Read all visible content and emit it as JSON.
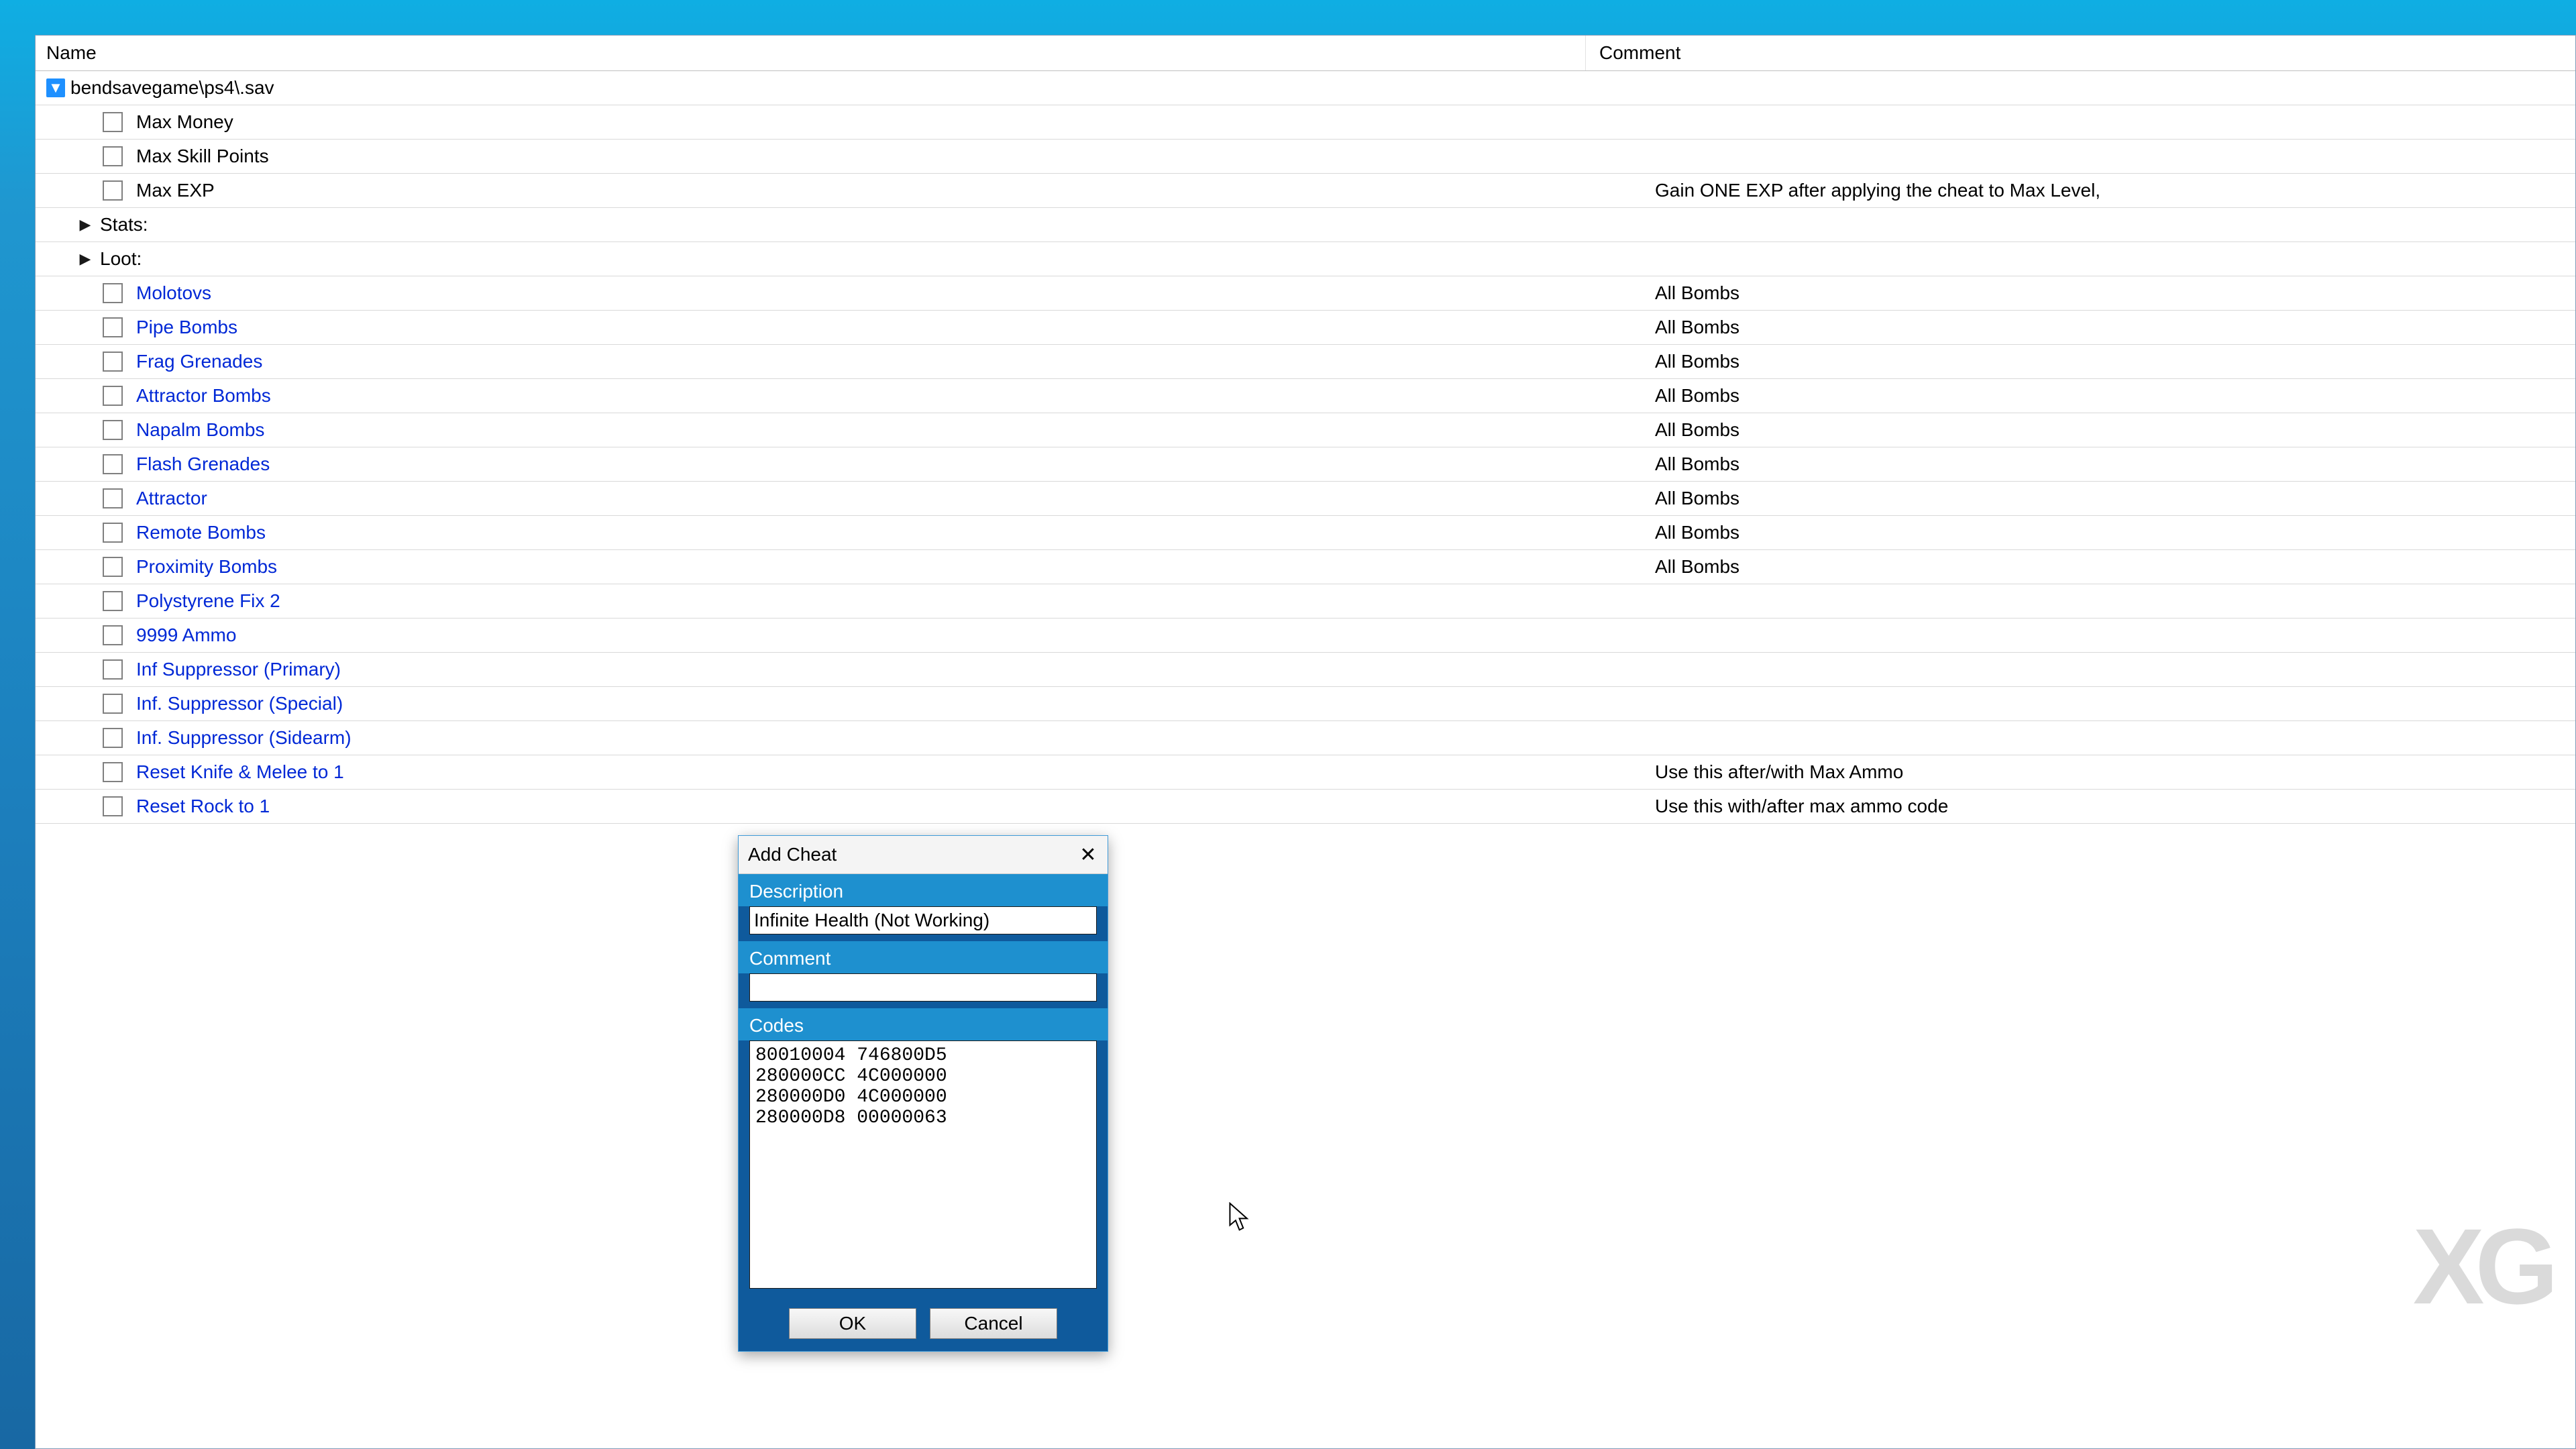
{
  "table": {
    "headers": {
      "name": "Name",
      "comment": "Comment"
    },
    "root": {
      "label": "bendsavegame\\ps4\\.sav",
      "expanded": true
    },
    "rows": [
      {
        "kind": "cb",
        "indent": 2,
        "label": "Max Money",
        "link": false,
        "comment": ""
      },
      {
        "kind": "cb",
        "indent": 2,
        "label": "Max Skill Points",
        "link": false,
        "comment": ""
      },
      {
        "kind": "cb",
        "indent": 2,
        "label": "Max EXP",
        "link": false,
        "comment": "Gain ONE EXP after applying the cheat to Max Level,"
      },
      {
        "kind": "exp",
        "indent": 1,
        "label": "Stats:",
        "link": false,
        "comment": ""
      },
      {
        "kind": "exp",
        "indent": 1,
        "label": "Loot:",
        "link": false,
        "comment": ""
      },
      {
        "kind": "cb",
        "indent": 2,
        "label": "Molotovs",
        "link": true,
        "comment": "All Bombs"
      },
      {
        "kind": "cb",
        "indent": 2,
        "label": "Pipe Bombs",
        "link": true,
        "comment": "All Bombs"
      },
      {
        "kind": "cb",
        "indent": 2,
        "label": "Frag Grenades",
        "link": true,
        "comment": "All Bombs"
      },
      {
        "kind": "cb",
        "indent": 2,
        "label": "Attractor Bombs",
        "link": true,
        "comment": "All Bombs"
      },
      {
        "kind": "cb",
        "indent": 2,
        "label": "Napalm Bombs",
        "link": true,
        "comment": "All Bombs"
      },
      {
        "kind": "cb",
        "indent": 2,
        "label": "Flash Grenades",
        "link": true,
        "comment": "All Bombs"
      },
      {
        "kind": "cb",
        "indent": 2,
        "label": "Attractor",
        "link": true,
        "comment": "All Bombs"
      },
      {
        "kind": "cb",
        "indent": 2,
        "label": "Remote Bombs",
        "link": true,
        "comment": "All Bombs"
      },
      {
        "kind": "cb",
        "indent": 2,
        "label": "Proximity Bombs",
        "link": true,
        "comment": "All Bombs"
      },
      {
        "kind": "cb",
        "indent": 2,
        "label": "Polystyrene Fix 2",
        "link": true,
        "comment": ""
      },
      {
        "kind": "cb",
        "indent": 2,
        "label": "9999 Ammo",
        "link": true,
        "comment": ""
      },
      {
        "kind": "cb",
        "indent": 2,
        "label": "Inf Suppressor (Primary)",
        "link": true,
        "comment": ""
      },
      {
        "kind": "cb",
        "indent": 2,
        "label": "Inf. Suppressor (Special)",
        "link": true,
        "comment": ""
      },
      {
        "kind": "cb",
        "indent": 2,
        "label": "Inf. Suppressor (Sidearm)",
        "link": true,
        "comment": ""
      },
      {
        "kind": "cb",
        "indent": 2,
        "label": "Reset Knife & Melee to 1",
        "link": true,
        "comment": "Use this after/with Max Ammo"
      },
      {
        "kind": "cb",
        "indent": 2,
        "label": "Reset Rock to 1",
        "link": true,
        "comment": "Use this with/after max ammo code"
      }
    ]
  },
  "dialog": {
    "title": "Add Cheat",
    "labels": {
      "description": "Description",
      "comment": "Comment",
      "codes": "Codes",
      "ok": "OK",
      "cancel": "Cancel"
    },
    "values": {
      "description": "Infinite Health (Not Working)",
      "comment": "",
      "codes": "80010004 746800D5\n280000CC 4C000000\n280000D0 4C000000\n280000D8 00000063\n"
    }
  },
  "watermark": "XG"
}
